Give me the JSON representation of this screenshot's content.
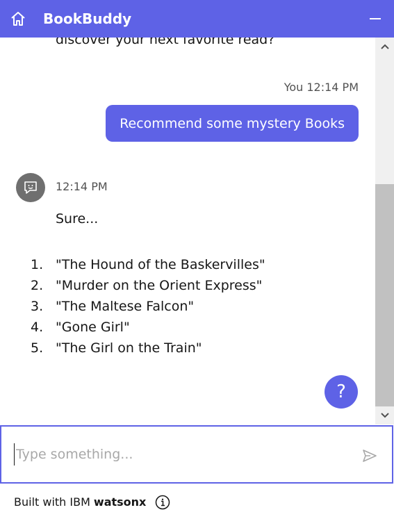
{
  "header": {
    "title": "BookBuddy",
    "home_icon": "home-icon",
    "minimize_icon": "minimize-icon"
  },
  "colors": {
    "accent": "#5e62e6",
    "avatar": "#6f6f6f"
  },
  "chat": {
    "previous_text": "discover your next favorite read?",
    "user_message": {
      "meta": "You 12:14 PM",
      "text": "Recommend some mystery Books"
    },
    "bot_message": {
      "time": "12:14 PM",
      "intro": "Sure...",
      "books": [
        {
          "num": "1.",
          "title": "\"The Hound of the Baskervilles\""
        },
        {
          "num": "2.",
          "title": "\"Murder on the Orient Express\""
        },
        {
          "num": "3.",
          "title": "\"The Maltese Falcon\""
        },
        {
          "num": "4.",
          "title": "\"Gone Girl\""
        },
        {
          "num": "5.",
          "title": "\"The Girl on the Train\""
        }
      ]
    },
    "help_label": "?"
  },
  "input": {
    "placeholder": "Type something...",
    "value": ""
  },
  "footer": {
    "prefix": "Built with IBM",
    "brand": "watsonx"
  }
}
